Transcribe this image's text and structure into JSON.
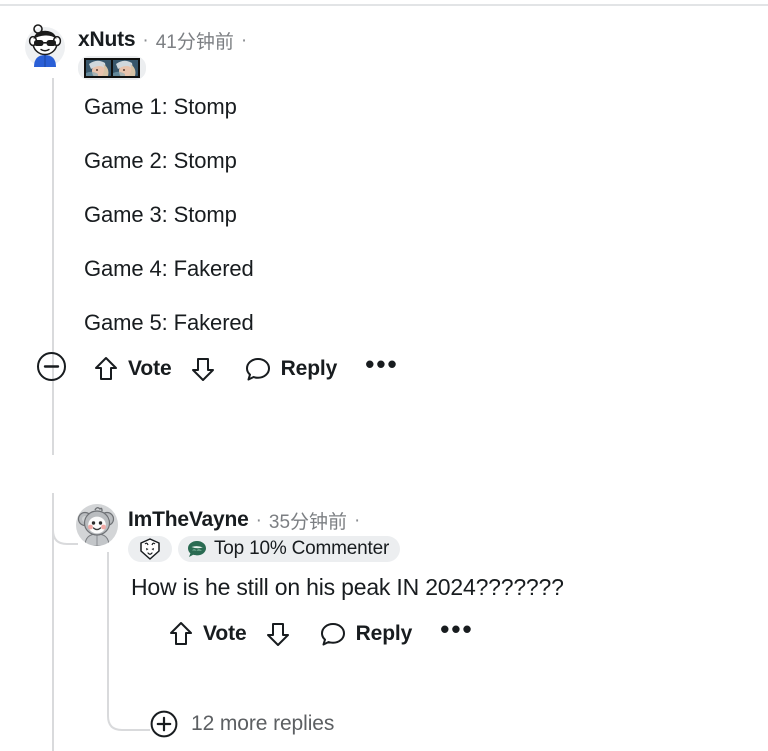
{
  "thread": {
    "comment": {
      "author": "xNuts",
      "timestamp": "41分钟前",
      "separator": "·",
      "avatar_icon": "snoo-sunglasses-avatar",
      "flair_icon": "champion-portrait-pair-flair",
      "body_lines": [
        "Game 1: Stomp",
        "Game 2: Stomp",
        "Game 3: Stomp",
        "Game 4: Fakered",
        "Game 5: Fakered"
      ],
      "actions": {
        "collapse_icon": "collapse-minus-icon",
        "upvote_icon": "upvote-arrow-icon",
        "vote_label": "Vote",
        "downvote_icon": "downvote-arrow-icon",
        "comment_icon": "speech-bubble-icon",
        "reply_label": "Reply",
        "overflow_label": "•••"
      }
    },
    "reply": {
      "author": "ImTheVayne",
      "timestamp": "35分钟前",
      "separator": "·",
      "avatar_icon": "snoo-koala-avatar",
      "g2_flair_icon": "g2-esports-logo-icon",
      "badge_icon": "top-commenter-bubble-icon",
      "badge_label": "Top 10% Commenter",
      "body": "How is he still on his peak IN 2024???????",
      "actions": {
        "upvote_icon": "upvote-arrow-icon",
        "vote_label": "Vote",
        "downvote_icon": "downvote-arrow-icon",
        "comment_icon": "speech-bubble-icon",
        "reply_label": "Reply",
        "overflow_label": "•••"
      }
    },
    "more_replies": {
      "expand_icon": "expand-plus-icon",
      "label": "12 more replies"
    }
  },
  "colors": {
    "text": "#181c1f",
    "muted": "#7c7f83",
    "pill": "#eceef0",
    "thread_line": "#d9dadc",
    "badge_green": "#2a6b52",
    "avatar_blue": "#2a5fd6"
  }
}
